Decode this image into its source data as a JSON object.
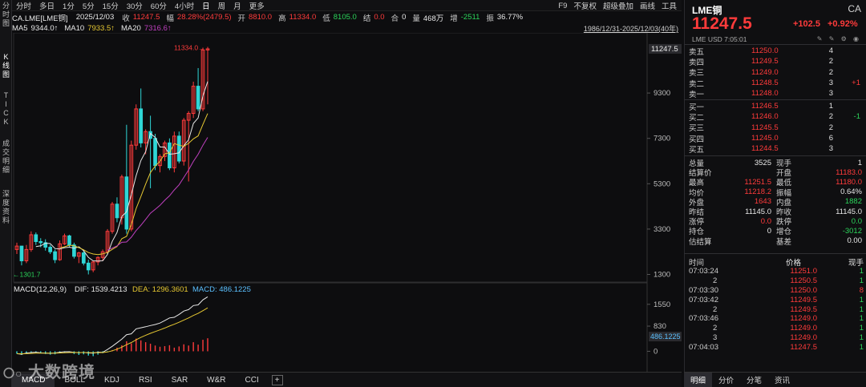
{
  "left_tabs": [
    "分时图",
    "K线图",
    "TICK",
    "成交明细",
    "深度资料"
  ],
  "topbar": {
    "periods": [
      "分时",
      "多日",
      "1分",
      "5分",
      "15分",
      "30分",
      "60分",
      "4小时",
      "日",
      "周",
      "月",
      "更多"
    ],
    "active_period": "日",
    "right_items": [
      "F9",
      "不复权",
      "超级叠加",
      "画线",
      "工具"
    ]
  },
  "quote": {
    "symbol": "CA.LME[LME铜]",
    "date": "2025/12/03",
    "close_label": "收",
    "close": "11247.5",
    "range_label": "幅",
    "range": "28.28%(2479.5)",
    "open_label": "开",
    "open": "8810.0",
    "high_label": "高",
    "high": "11334.0",
    "low_label": "低",
    "low": "8105.0",
    "settle_label": "结",
    "settle": "0.0",
    "oi_label": "合",
    "oi": "0",
    "vol_label": "量",
    "vol": "468万",
    "inc_label": "增",
    "inc": "-2511",
    "amp_label": "振",
    "amp": "36.77%"
  },
  "ma": {
    "ma5_label": "MA5",
    "ma5": "9344.0↑",
    "ma10_label": "MA10",
    "ma10": "7933.5↑",
    "ma20_label": "MA20",
    "ma20": "7316.6↑",
    "range_text": "1986/12/31-2025/12/03(40年)"
  },
  "macd": {
    "label": "MACD(12,26,9)",
    "dif_label": "DIF:",
    "dif": "1539.4213",
    "dea_label": "DEA:",
    "dea": "1296.3601",
    "macd_label": "MACD:",
    "macd": "486.1225"
  },
  "chart_data": {
    "type": "candlestick",
    "yticks": [
      9300,
      7300,
      5300,
      3300,
      1300
    ],
    "y_current_label": "11247.5",
    "high_annotation": "11334.0",
    "low_annotation": "1301.7",
    "macd_yticks": [
      "1550",
      "830",
      "0"
    ],
    "macd_current_label": "486.1225",
    "colors": {
      "up": "#ff3b3b",
      "down": "#2fd6d6",
      "ma5": "#e8e8e8",
      "ma10": "#e6c832",
      "ma20": "#c040c0",
      "bg": "#0d0d0f"
    },
    "candles": [
      [
        2400,
        2700,
        2200,
        2550
      ],
      [
        2550,
        2550,
        1700,
        1900
      ],
      [
        1900,
        2600,
        1800,
        2400
      ],
      [
        2400,
        3200,
        2300,
        3050
      ],
      [
        3050,
        3150,
        2600,
        2750
      ],
      [
        2750,
        2900,
        2500,
        2700
      ],
      [
        2700,
        2850,
        2350,
        2500
      ],
      [
        2500,
        2600,
        2200,
        2300
      ],
      [
        2300,
        2400,
        1800,
        1950
      ],
      [
        1950,
        2800,
        1900,
        2650
      ],
      [
        2650,
        3100,
        2600,
        3000
      ],
      [
        3000,
        3050,
        2500,
        2600
      ],
      [
        2600,
        2700,
        2000,
        2100
      ],
      [
        2100,
        2300,
        1800,
        2250
      ],
      [
        2250,
        2400,
        1700,
        1800
      ],
      [
        1800,
        1950,
        1300,
        1500
      ],
      [
        1500,
        1900,
        1400,
        1850
      ],
      [
        1850,
        2100,
        1700,
        2050
      ],
      [
        2050,
        2400,
        1900,
        2300
      ],
      [
        2300,
        3300,
        2200,
        3200
      ],
      [
        3200,
        4500,
        3100,
        4400
      ],
      [
        4400,
        4700,
        3600,
        3800
      ],
      [
        3800,
        5700,
        3500,
        5600
      ],
      [
        5600,
        7900,
        3100,
        3300
      ],
      [
        3300,
        7200,
        3200,
        7000
      ],
      [
        7000,
        8800,
        6800,
        8600
      ],
      [
        8600,
        9500,
        6900,
        7100
      ],
      [
        7100,
        7700,
        6600,
        7600
      ],
      [
        7600,
        8300,
        5100,
        7300
      ],
      [
        7300,
        7500,
        5900,
        6100
      ],
      [
        6100,
        6600,
        5800,
        6500
      ],
      [
        6500,
        7200,
        6300,
        7100
      ],
      [
        7100,
        7300,
        5900,
        6000
      ],
      [
        6000,
        7600,
        5800,
        7400
      ],
      [
        7400,
        7600,
        6200,
        6300
      ],
      [
        6300,
        8200,
        6100,
        8100
      ],
      [
        8100,
        8500,
        5400,
        8400
      ],
      [
        8400,
        9800,
        8200,
        9600
      ],
      [
        9600,
        10400,
        8500,
        8600
      ],
      [
        8600,
        11300,
        8500,
        11200
      ],
      [
        11200,
        11334,
        8800,
        11247.5
      ]
    ],
    "macd_hist": [
      -80,
      -120,
      -60,
      -40,
      -30,
      -70,
      -90,
      -110,
      -100,
      -60,
      -40,
      -50,
      -90,
      -120,
      -100,
      -140,
      -160,
      -110,
      -60,
      -20,
      40,
      120,
      200,
      330,
      260,
      420,
      360,
      300,
      250,
      190,
      150,
      170,
      200,
      120,
      160,
      230,
      190,
      300,
      220,
      380,
      430
    ]
  },
  "bottom_tabs": [
    "MACD",
    "BOLL",
    "KDJ",
    "RSI",
    "SAR",
    "W&R",
    "CCI"
  ],
  "watermark": "大数跨境",
  "right_panel": {
    "title": "LME铜",
    "code": "CA",
    "price": "11247.5",
    "change": "+102.5",
    "change_pct": "+0.92%",
    "meta": "LME  USD  7:05:01",
    "asks": [
      {
        "label": "卖五",
        "price": "11250.0",
        "qty": "4",
        "delta": ""
      },
      {
        "label": "卖四",
        "price": "11249.5",
        "qty": "2",
        "delta": ""
      },
      {
        "label": "卖三",
        "price": "11249.0",
        "qty": "2",
        "delta": ""
      },
      {
        "label": "卖二",
        "price": "11248.5",
        "qty": "3",
        "delta": "+1"
      },
      {
        "label": "卖一",
        "price": "11248.0",
        "qty": "3",
        "delta": ""
      }
    ],
    "bids": [
      {
        "label": "买一",
        "price": "11246.5",
        "qty": "1",
        "delta": ""
      },
      {
        "label": "买二",
        "price": "11246.0",
        "qty": "2",
        "delta": "-1"
      },
      {
        "label": "买三",
        "price": "11245.5",
        "qty": "2",
        "delta": ""
      },
      {
        "label": "买四",
        "price": "11245.0",
        "qty": "6",
        "delta": ""
      },
      {
        "label": "买五",
        "price": "11244.5",
        "qty": "3",
        "delta": ""
      }
    ],
    "stats": [
      {
        "k": "总量",
        "v": "3525",
        "vc": "white",
        "k2": "现手",
        "v2": "1",
        "v2c": "white"
      },
      {
        "k": "结算价",
        "v": "",
        "vc": "white",
        "k2": "开盘",
        "v2": "11183.0",
        "v2c": "red"
      },
      {
        "k": "最高",
        "v": "11251.5",
        "vc": "red",
        "k2": "最低",
        "v2": "11180.0",
        "v2c": "red"
      },
      {
        "k": "均价",
        "v": "11218.2",
        "vc": "red",
        "k2": "振幅",
        "v2": "0.64%",
        "v2c": "white"
      },
      {
        "k": "外盘",
        "v": "1643",
        "vc": "red",
        "k2": "内盘",
        "v2": "1882",
        "v2c": "green"
      },
      {
        "k": "昨结",
        "v": "11145.0",
        "vc": "white",
        "k2": "昨收",
        "v2": "11145.0",
        "v2c": "white"
      },
      {
        "k": "涨停",
        "v": "0.0",
        "vc": "red",
        "k2": "跌停",
        "v2": "0.0",
        "v2c": "green"
      },
      {
        "k": "持仓",
        "v": "0",
        "vc": "white",
        "k2": "增仓",
        "v2": "-3012",
        "v2c": "green"
      },
      {
        "k": "估结算",
        "v": "",
        "vc": "white",
        "k2": "基差",
        "v2": "0.00",
        "v2c": "white"
      }
    ],
    "ticks_header": {
      "time": "时间",
      "price": "价格",
      "qty": "现手"
    },
    "ticks": [
      {
        "t": "07:03:24",
        "p": "11251.0",
        "q": "1"
      },
      {
        "t": "2",
        "p": "11250.5",
        "q": "1"
      },
      {
        "t": "07:03:30",
        "p": "11250.0",
        "q": "8"
      },
      {
        "t": "07:03:42",
        "p": "11249.5",
        "q": "1"
      },
      {
        "t": "2",
        "p": "11249.5",
        "q": "1"
      },
      {
        "t": "07:03:46",
        "p": "11249.0",
        "q": "1"
      },
      {
        "t": "2",
        "p": "11249.0",
        "q": "1"
      },
      {
        "t": "3",
        "p": "11249.0",
        "q": "1"
      },
      {
        "t": "07:04:03",
        "p": "11247.5",
        "q": "1"
      }
    ],
    "bottom_tabs": [
      "明细",
      "分价",
      "分笔",
      "资讯"
    ]
  }
}
